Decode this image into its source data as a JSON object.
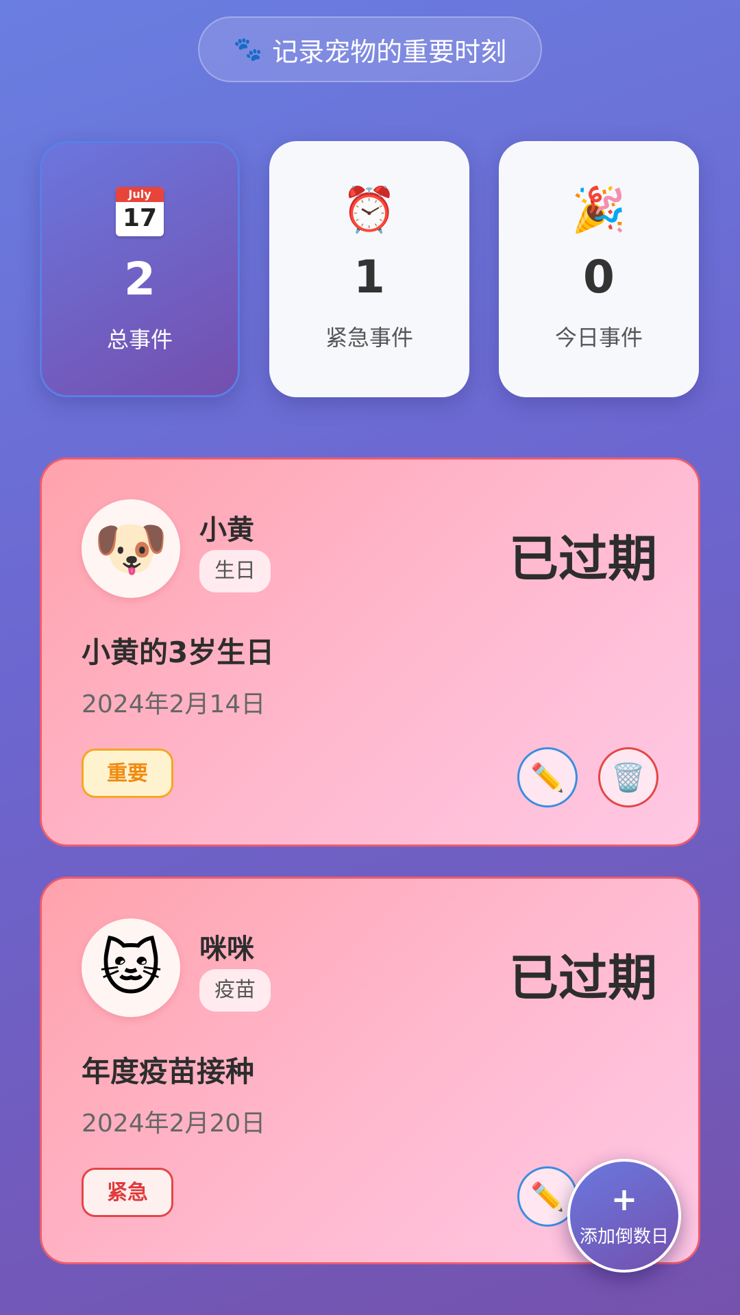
{
  "header": {
    "tagline": "记录宠物的重要时刻",
    "icon": "paw-icon"
  },
  "stats": [
    {
      "icon": "calendar-icon",
      "icon_month": "July",
      "icon_day": "17",
      "value": "2",
      "label": "总事件"
    },
    {
      "icon": "alarm-clock-icon",
      "value": "1",
      "label": "紧急事件"
    },
    {
      "icon": "party-popper-icon",
      "value": "0",
      "label": "今日事件"
    }
  ],
  "events": [
    {
      "pet_name": "小黄",
      "pet_emoji": "🐶",
      "type": "生日",
      "status": "已过期",
      "title": "小黄的3岁生日",
      "date": "2024年2月14日",
      "priority": "重要",
      "edit_icon": "✏️",
      "delete_icon": "🗑️"
    },
    {
      "pet_name": "咪咪",
      "pet_emoji": "🐱",
      "type": "疫苗",
      "status": "已过期",
      "title": "年度疫苗接种",
      "date": "2024年2月20日",
      "priority": "紧急",
      "edit_icon": "✏️",
      "delete_icon": "🗑️"
    }
  ],
  "fab": {
    "plus": "+",
    "label": "添加倒数日"
  },
  "colors": {
    "accent": "#6c66cf",
    "important": "#f5a623",
    "urgent": "#e54545",
    "edit": "#3a8de0"
  }
}
